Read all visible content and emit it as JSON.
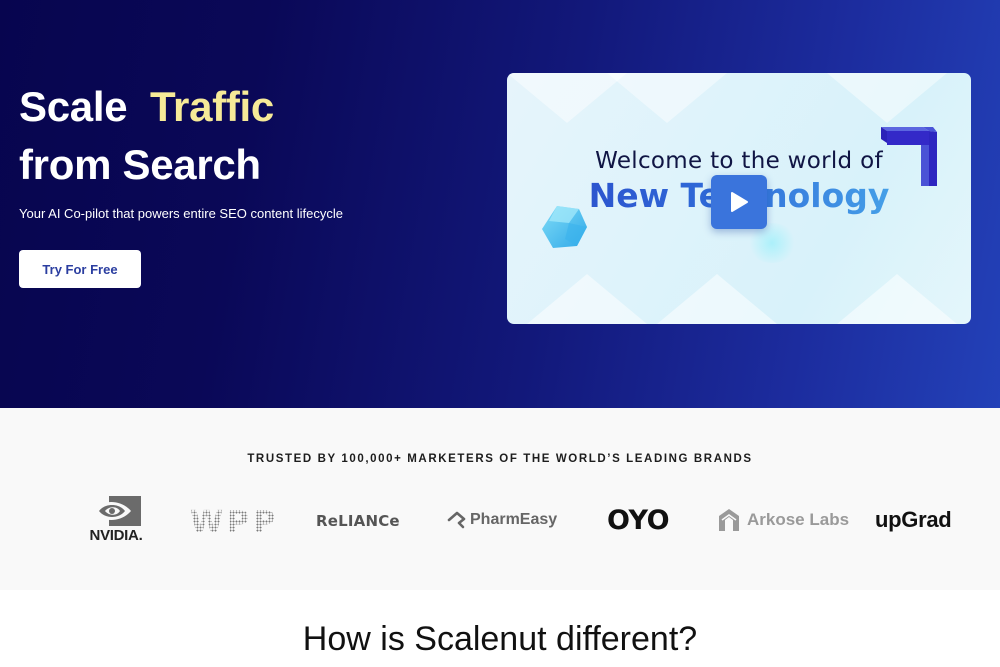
{
  "hero": {
    "title_word1": "Scale",
    "title_accent": "Traffic",
    "title_line2": "from Search",
    "subtitle": "Your AI Co-pilot that powers entire SEO content lifecycle",
    "cta_label": "Try For Free",
    "accent_color": "#f6ea98"
  },
  "video": {
    "line1": "Welcome to the world of",
    "line2": "New Technology",
    "play_icon": "play-icon"
  },
  "trusted": {
    "heading": "TRUSTED BY 100,000+ MARKETERS OF THE WORLD’S LEADING BRANDS",
    "logos": [
      {
        "name": "NVIDIA",
        "text": "NVIDIA."
      },
      {
        "name": "WPP",
        "text": "WPP"
      },
      {
        "name": "Reliance",
        "text": "ReLIANCe"
      },
      {
        "name": "PharmEasy",
        "text": "PharmEasy"
      },
      {
        "name": "OYO",
        "text": "OYO"
      },
      {
        "name": "Arkose Labs",
        "text": "Arkose Labs"
      },
      {
        "name": "upGrad",
        "text": "upGrad"
      }
    ]
  },
  "different": {
    "prefix": "How is Scalenut ",
    "highlight": "different",
    "suffix": "?",
    "highlight_color": "#6fd0f2"
  }
}
